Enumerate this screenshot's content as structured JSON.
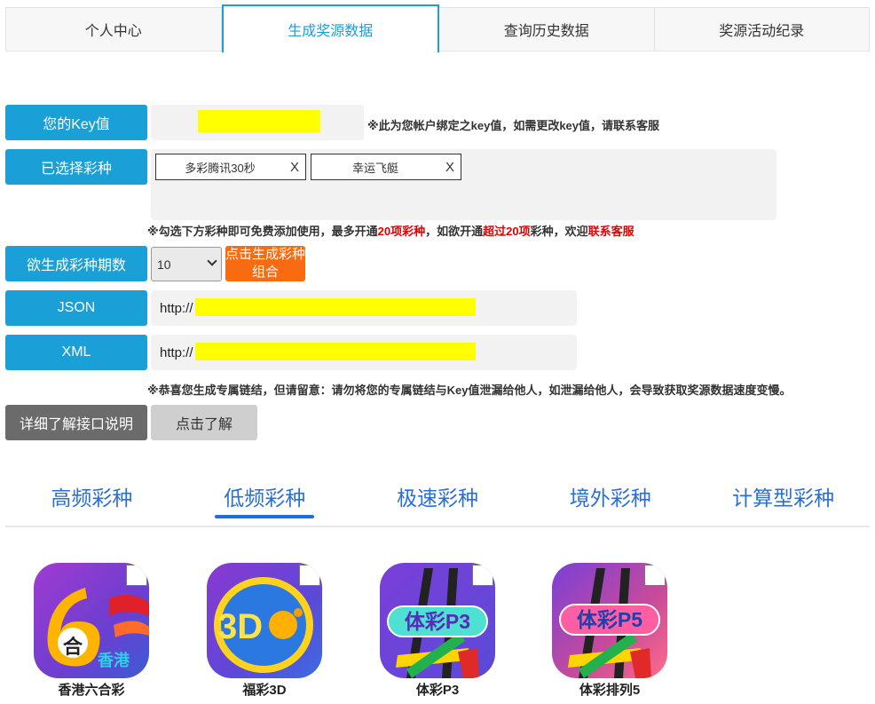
{
  "top_tabs": [
    "个人中心",
    "生成奖源数据",
    "查询历史数据",
    "奖源活动纪录"
  ],
  "form": {
    "key_label": "您的Key值",
    "key_note": "※此为您帐户绑定之key值，如需更改key值，请联系客服",
    "selected_label": "已选择彩种",
    "selected_items": [
      "多彩腾讯30秒",
      "幸运飞艇"
    ],
    "remove_mark": "X",
    "select_note_a": "※勾选下方彩种即可免费添加使用，最多开通",
    "select_note_b": "20项彩种",
    "select_note_c": "，如欲开通",
    "select_note_d": "超过20项",
    "select_note_e": "彩种，欢迎",
    "select_note_f": "联系客服",
    "periods_label": "欲生成彩种期数",
    "periods_value": "10",
    "generate_button": "点击生成彩种组合",
    "json_label": "JSON",
    "json_prefix": "http://",
    "xml_label": "XML",
    "xml_prefix": "http://",
    "link_note": "※恭喜您生成专属链结，但请留意：请勿将您的专属链结与Key值泄漏给他人，如泄漏给他人，会导致获取奖源数据速度变慢。",
    "detail_button": "详细了解接口说明",
    "learn_button": "点击了解"
  },
  "category_tabs": [
    "高频彩种",
    "低频彩种",
    "极速彩种",
    "境外彩种",
    "计算型彩种"
  ],
  "active_category": 1,
  "lotteries": [
    {
      "name": "香港六合彩",
      "icon": "hk-mark-six-icon",
      "badge1": "合",
      "badge2": "香港"
    },
    {
      "name": "福彩3D",
      "icon": "welfare-3d-icon",
      "badge1": "3D"
    },
    {
      "name": "体彩P3",
      "icon": "sports-p3-icon",
      "badge1": "体彩P3"
    },
    {
      "name": "体彩排列5",
      "icon": "sports-p5-icon",
      "badge1": "体彩P5"
    }
  ],
  "colors": {
    "primary": "#1a9fd6",
    "orange": "#f96b10",
    "highlight": "#ffff00",
    "tab_text": "#2a6fd6"
  }
}
